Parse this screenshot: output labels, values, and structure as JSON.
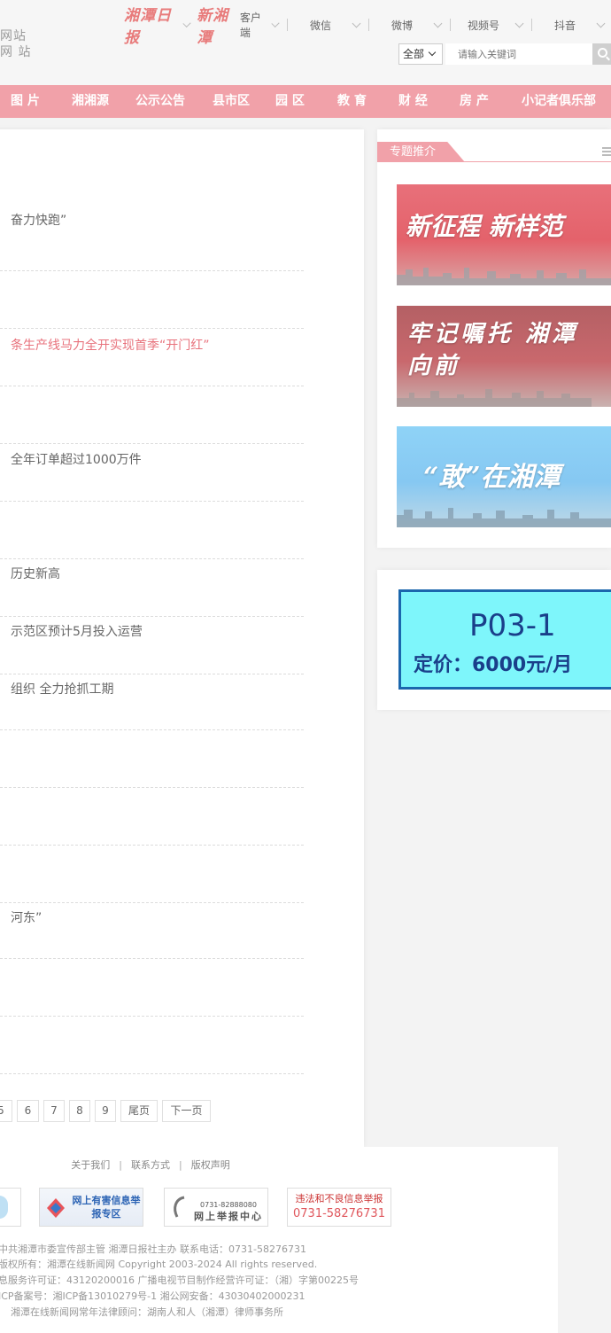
{
  "header": {
    "site_name_lines": [
      "网站",
      "网 站"
    ],
    "brands": [
      "湘潭日报",
      "新湘潭"
    ],
    "client_label": "客户端",
    "social": [
      "微信",
      "微博",
      "视频号",
      "抖音"
    ],
    "search": {
      "scope": "全部",
      "placeholder": "请输入关键词"
    }
  },
  "nav": [
    "图 片",
    "湘湘源",
    "公示公告",
    "县市区",
    "园 区",
    "教 育",
    "财 经",
    "房 产",
    "小记者俱乐部"
  ],
  "news": [
    {
      "title": "奋力快跑”",
      "highlight": false
    },
    {
      "title": "",
      "highlight": false
    },
    {
      "title": "条生产线马力全开实现首季“开门红”",
      "highlight": true
    },
    {
      "title": "",
      "highlight": false
    },
    {
      "title": "全年订单超过1000万件",
      "highlight": false
    },
    {
      "title": "",
      "highlight": false
    },
    {
      "title": "历史新高",
      "highlight": false
    },
    {
      "title": "示范区预计5月投入运营",
      "highlight": false
    },
    {
      "title": "组织 全力抢抓工期",
      "highlight": false
    },
    {
      "title": "",
      "highlight": false
    },
    {
      "title": "",
      "highlight": false
    },
    {
      "title": "",
      "highlight": false
    },
    {
      "title": "河东”",
      "highlight": false
    },
    {
      "title": "",
      "highlight": false
    },
    {
      "title": "",
      "highlight": false
    }
  ],
  "pagination": [
    "5",
    "6",
    "7",
    "8",
    "9",
    "尾页",
    "下一页"
  ],
  "topic": {
    "heading": "专题推介",
    "banners": [
      {
        "title": "新征程 新样范",
        "theme": "#e4626b"
      },
      {
        "title": "牢记嘱托 湘潭向前",
        "theme": "#c9686d"
      },
      {
        "title": "“敢”在湘潭",
        "theme": "#86c8f2"
      }
    ]
  },
  "ad": {
    "code": "P03-1",
    "price": "定价：6000元/月"
  },
  "footer": {
    "links": [
      "关于我们",
      "联系方式",
      "版权声明"
    ],
    "badges": [
      "网上有害信息举报专区",
      "网上举报中心",
      "违法和不良信息举报"
    ],
    "badge_phones": [
      "0731-82888080",
      "0731-58276731"
    ],
    "lines": [
      "中共湘潭市委宣传部主管 湘潭日报社主办 联系电话：0731-58276731",
      "版权所有：湘潭在线新闻网 Copyright 2003-2024 All rights reserved.",
      "息服务许可证：43120200016 广播电视节目制作经营许可证：（湘）字第00225号",
      "ICP备案号：湘ICP备13010279号-1 湘公网安备：43030402000231",
      "湘潭在线新闻网常年法律顾问：湖南人和人（湘潭）律师事务所"
    ]
  }
}
